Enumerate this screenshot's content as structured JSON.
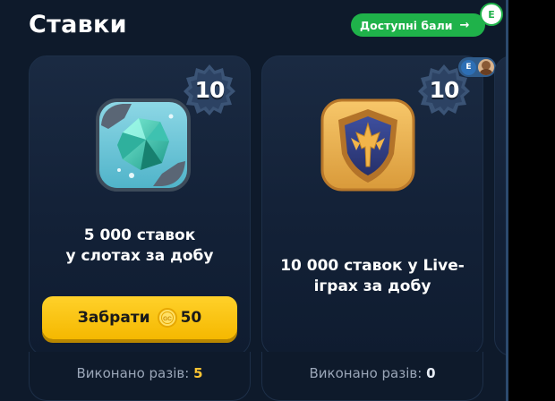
{
  "header": {
    "title": "Ставки",
    "points_button_label": "Доступні бали",
    "points_button_arrow": "→",
    "user_initial": "E"
  },
  "cards": [
    {
      "badge_value": "10",
      "icon": "crystal-gem-icon",
      "text_line1": "5 000 ставок",
      "text_line2": "у слотах за добу",
      "claim_label": "Забрати",
      "claim_amount": "50",
      "coin_label": "GC",
      "done_label": "Виконано разів:",
      "done_count": "5"
    },
    {
      "badge_value": "10",
      "icon": "shield-trident-icon",
      "text_line1": "10 000 ставок у Live-",
      "text_line2": "іграх за добу",
      "participant_initial": "E",
      "done_label": "Виконано разів:",
      "done_count": "0"
    }
  ],
  "colors": {
    "background": "#0e1a2b",
    "card": "#15243a",
    "accent_green": "#1fb24a",
    "button_yellow": "#ffcc1a",
    "count_gold": "#ffc533"
  }
}
